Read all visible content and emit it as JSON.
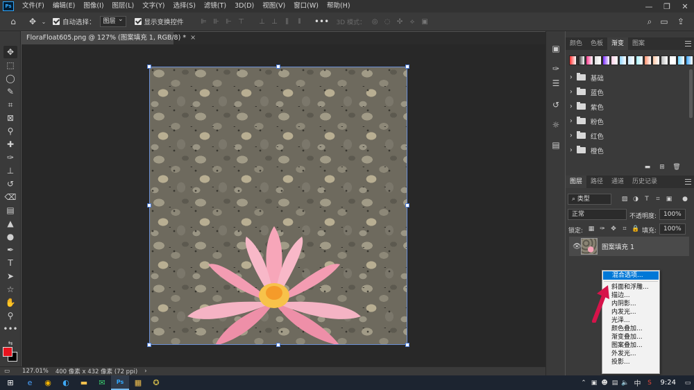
{
  "menubar": {
    "logo": "Ps",
    "items": [
      "文件(F)",
      "编辑(E)",
      "图像(I)",
      "图层(L)",
      "文字(Y)",
      "选择(S)",
      "滤镜(T)",
      "3D(D)",
      "视图(V)",
      "窗口(W)",
      "帮助(H)"
    ]
  },
  "options": {
    "auto_select_label": "自动选择：",
    "auto_select_value": "图层",
    "show_transform_label": "显示变换控件",
    "mode3d_label": "3D 模式："
  },
  "document": {
    "tab_title": "FloraFloat605.png @ 127% (图案填充 1, RGB/8) *",
    "zoom": "127.01%",
    "size_info": "400 像素 x 432 像素 (72 ppi)"
  },
  "panels": {
    "top_tabs": [
      "颜色",
      "色板",
      "渐变",
      "图案"
    ],
    "gradient_groups": [
      "基础",
      "蓝色",
      "紫色",
      "粉色",
      "红色",
      "橙色"
    ],
    "gradient_swatches": [
      "#ff2f2f",
      "#1a1a1a",
      "#ff3a8c",
      "#e0e0e0",
      "#7a2bff",
      "#ffd1e8",
      "#8fd3ff",
      "#c7e7ff",
      "#a7f0ff",
      "#ff8f6b",
      "#ffc8a8",
      "#c0c0c0",
      "#ffffff",
      "#6bd1ff",
      "#3aa6ff",
      "#ffe066",
      "#b0b0b0"
    ],
    "layer_tabs": [
      "图层",
      "路径",
      "通道",
      "历史记录"
    ],
    "filter_kind": "类型",
    "blend_mode": "正常",
    "opacity_label": "不透明度:",
    "opacity_value": "100%",
    "lock_label": "锁定:",
    "fill_label": "填充:",
    "fill_value": "100%",
    "layer_name": "图案填充 1"
  },
  "context_menu": {
    "items": [
      "混合选项...",
      "斜面和浮雕...",
      "描边...",
      "内阴影...",
      "内发光...",
      "光泽...",
      "颜色叠加...",
      "渐变叠加...",
      "图案叠加...",
      "外发光...",
      "投影..."
    ]
  },
  "taskbar": {
    "time": "9:24",
    "ime": "中"
  },
  "colors": {
    "foreground": "#e8131e",
    "background": "#000000",
    "highlight": "#0078d7"
  }
}
